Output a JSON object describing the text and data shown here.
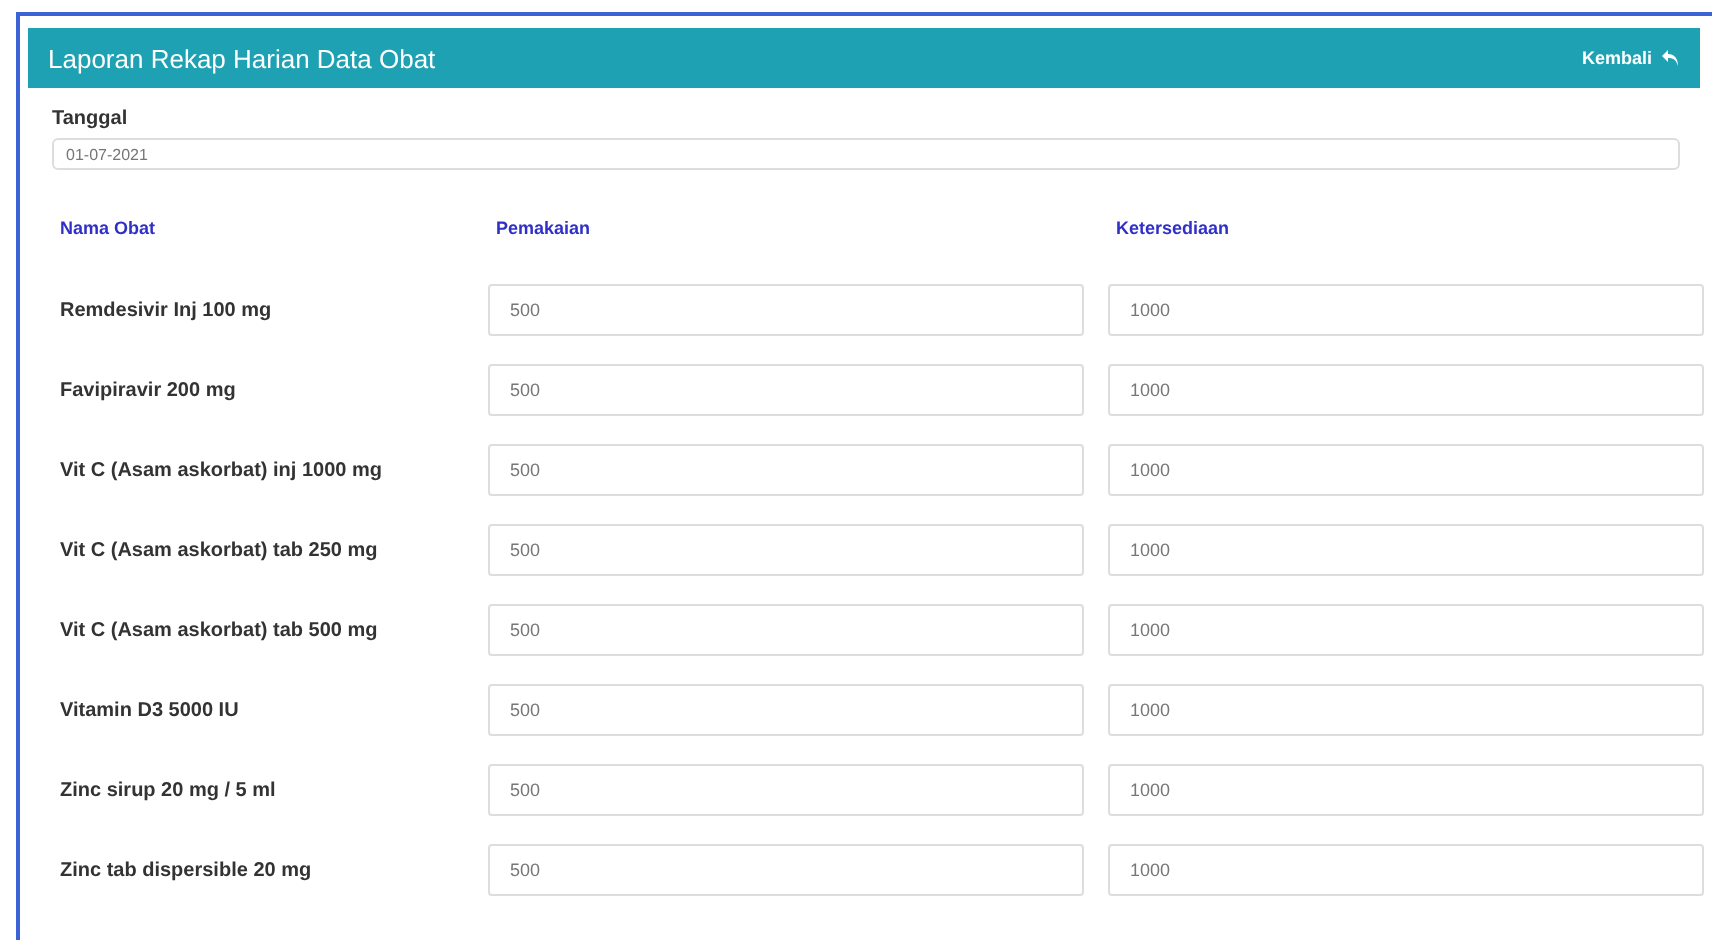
{
  "header": {
    "title": "Laporan Rekap Harian Data Obat",
    "back_link": "Kembali"
  },
  "date_field": {
    "label": "Tanggal",
    "value": "01-07-2021"
  },
  "table": {
    "columns": [
      "Nama Obat",
      "Pemakaian",
      "Ketersediaan"
    ],
    "rows": [
      {
        "name": "Remdesivir Inj 100 mg",
        "usage": "500",
        "stock": "1000"
      },
      {
        "name": "Favipiravir 200 mg",
        "usage": "500",
        "stock": "1000"
      },
      {
        "name": "Vit C (Asam askorbat) inj 1000 mg",
        "usage": "500",
        "stock": "1000"
      },
      {
        "name": "Vit C (Asam askorbat) tab 250 mg",
        "usage": "500",
        "stock": "1000"
      },
      {
        "name": "Vit C (Asam askorbat) tab 500 mg",
        "usage": "500",
        "stock": "1000"
      },
      {
        "name": "Vitamin D3 5000 IU",
        "usage": "500",
        "stock": "1000"
      },
      {
        "name": "Zinc sirup 20 mg / 5 ml",
        "usage": "500",
        "stock": "1000"
      },
      {
        "name": "Zinc tab dispersible 20 mg",
        "usage": "500",
        "stock": "1000"
      }
    ]
  }
}
